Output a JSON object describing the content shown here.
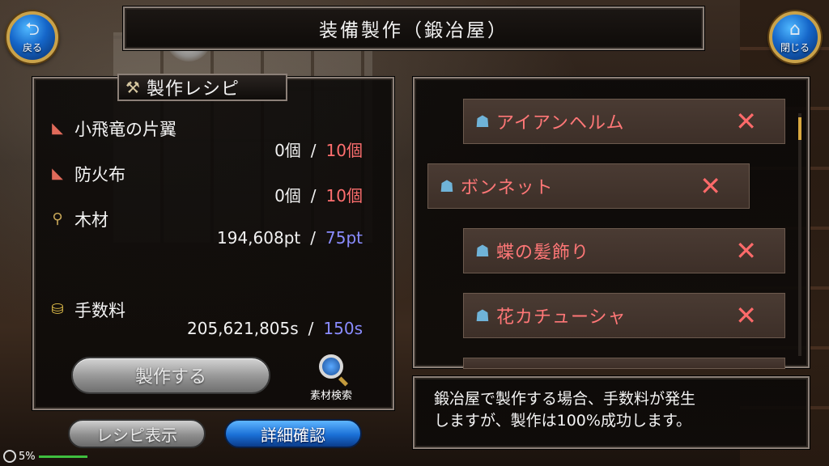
{
  "header": {
    "title": "装備製作（鍛冶屋）",
    "back_label": "戻る",
    "close_label": "閉じる"
  },
  "recipe": {
    "title": "製作レシピ",
    "materials": [
      {
        "name": "小飛竜の片翼",
        "owned": "0個",
        "separator": "/",
        "required": "10個",
        "icon": "cloth-icon"
      },
      {
        "name": "防火布",
        "owned": "0個",
        "separator": "/",
        "required": "10個",
        "icon": "cloth-icon"
      },
      {
        "name": "木材",
        "owned": "194,608pt",
        "separator": "/",
        "required": "75pt",
        "icon": "wood-icon"
      }
    ],
    "fee": {
      "name": "手数料",
      "owned": "205,621,805s",
      "separator": "/",
      "required": "150s",
      "icon": "coin-icon"
    },
    "craft_button": "製作する",
    "search_label": "素材検索"
  },
  "buttons": {
    "recipe_display": "レシピ表示",
    "detail_confirm": "詳細確認"
  },
  "items": [
    {
      "name": "アイアンヘルム",
      "selected": false
    },
    {
      "name": "ボンネット",
      "selected": true
    },
    {
      "name": "蝶の髪飾り",
      "selected": false
    },
    {
      "name": "花カチューシャ",
      "selected": false
    }
  ],
  "info": {
    "line1": "鍛冶屋で製作する場合、手数料が発生",
    "line2": "しますが、製作は100%成功します。"
  },
  "status": {
    "battery": "5%"
  },
  "colors": {
    "required_red": "#ff6f6f",
    "required_blue": "#8a8cff",
    "item_name": "#ff7777",
    "detail_button": "#1a6fd6"
  }
}
